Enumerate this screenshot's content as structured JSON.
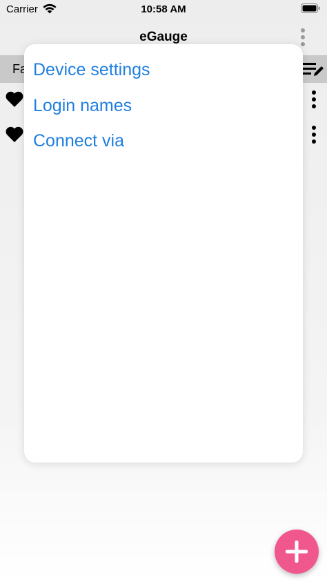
{
  "status_bar": {
    "carrier": "Carrier",
    "time": "10:58 AM",
    "wifi_icon": "wifi-icon",
    "battery_icon": "battery-icon"
  },
  "nav": {
    "title": "eGauge",
    "more_icon": "more-vertical-icon"
  },
  "tab_row": {
    "label": "Fa",
    "edit_icon": "edit-list-icon",
    "color": "#c9c9c9"
  },
  "device_rows": [
    {
      "icon": "heart-icon",
      "more_icon": "more-vertical-icon"
    },
    {
      "icon": "heart-icon",
      "more_icon": "more-vertical-icon"
    }
  ],
  "popup_menu": {
    "items": [
      {
        "label": "Device settings"
      },
      {
        "label": "Login names"
      },
      {
        "label": "Connect via"
      }
    ],
    "text_color": "#1f7fe0"
  },
  "fab": {
    "icon": "plus-icon",
    "color": "#f0578d"
  }
}
